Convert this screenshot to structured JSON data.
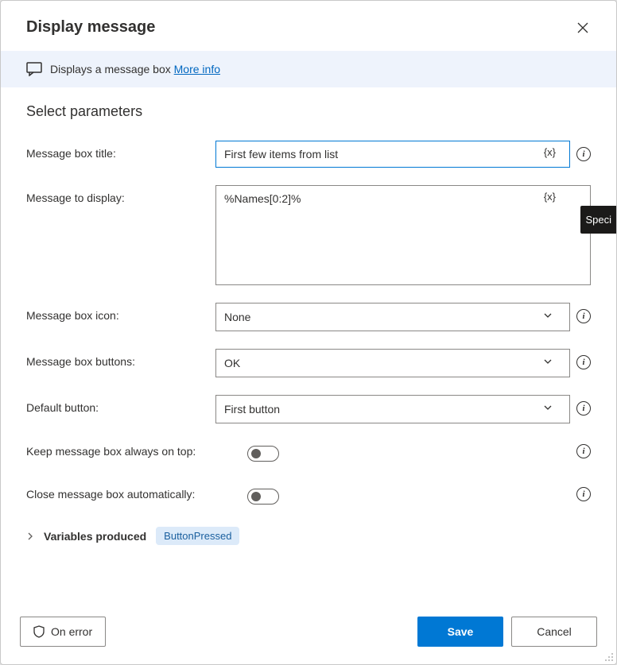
{
  "header": {
    "title": "Display message"
  },
  "banner": {
    "text": "Displays a message box ",
    "link_label": "More info"
  },
  "section": {
    "title": "Select parameters"
  },
  "fields": {
    "title_label": "Message box title:",
    "title_value": "First few items from list",
    "message_label": "Message to display:",
    "message_value": "%Names[0:2]%",
    "icon_label": "Message box icon:",
    "icon_value": "None",
    "buttons_label": "Message box buttons:",
    "buttons_value": "OK",
    "default_label": "Default button:",
    "default_value": "First button",
    "ontop_label": "Keep message box always on top:",
    "autoclose_label": "Close message box automatically:",
    "var_token": "{x}"
  },
  "variables": {
    "label": "Variables produced",
    "badge": "ButtonPressed"
  },
  "footer": {
    "onerror": "On error",
    "save": "Save",
    "cancel": "Cancel"
  },
  "tooltip": {
    "text": "Speci"
  }
}
